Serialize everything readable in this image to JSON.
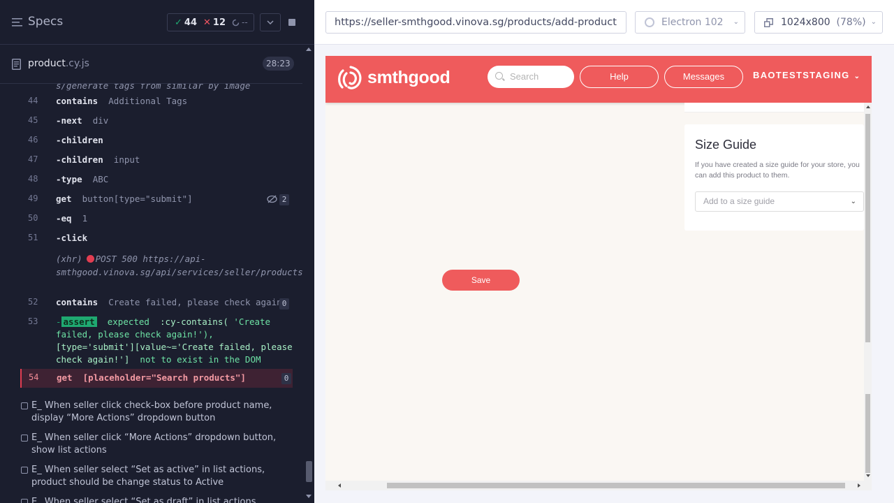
{
  "reporter": {
    "specs_label": "Specs",
    "stats": {
      "passed": "44",
      "failed": "12",
      "pending": "--"
    },
    "file": {
      "name": "product",
      "ext": ".cy.js",
      "duration": "28:23"
    },
    "cut_line": "s/generate tags from similar by image",
    "commands": [
      {
        "num": "44",
        "name": "contains",
        "msg": "Additional Tags"
      },
      {
        "num": "45",
        "name": "-next",
        "msg": "div"
      },
      {
        "num": "46",
        "name": "-children",
        "msg": ""
      },
      {
        "num": "47",
        "name": "-children",
        "msg": "input"
      },
      {
        "num": "48",
        "name": "-type",
        "msg": "ABC"
      },
      {
        "num": "49",
        "name": "get",
        "msg": "button[type=\"submit\"]",
        "badge": "2"
      },
      {
        "num": "50",
        "name": "-eq",
        "msg": "1"
      },
      {
        "num": "51",
        "name": "-click",
        "msg": ""
      },
      {
        "num": "52",
        "name": "contains",
        "msg": "Create failed, please check again!",
        "badge": "0"
      },
      {
        "num": "53",
        "name": "-",
        "msg": ""
      },
      {
        "num": "54",
        "name": "get",
        "msg": "[placeholder=\"Search products\"]",
        "badge": "0"
      }
    ],
    "xhr": {
      "label": "(xhr)",
      "text": "POST 500 https://api-smthgood.vinova.sg/api/services/seller/products"
    },
    "assert": {
      "tag": "assert",
      "line1_a": "expected",
      "line1_b": ":cy-contains(",
      "line1_c": "'Create",
      "line2": "failed, please check again!'),",
      "line3": "[type='submit'][value~='Create failed, please",
      "line4_a": "check again!']",
      "line4_b": "not to exist in the DOM"
    },
    "tests": [
      "E_ When seller click check-box before product name, display “More Actions” dropdown button",
      "E_ When seller click “More Actions” dropdown button, show list actions",
      "E_ When seller select “Set as active” in list actions, product should be change status to Active",
      "E_ When seller select “Set as draft” in list actions, product should be change status to Draft"
    ]
  },
  "aut": {
    "url": "https://seller-smthgood.vinova.sg/products/add-product",
    "browser": "Electron 102",
    "viewport": "1024x800",
    "zoom": "(78%)"
  },
  "site": {
    "logo_text": "smthgood",
    "search_placeholder": "Search",
    "help": "Help",
    "messages": "Messages",
    "account": "BAOTESTSTAGING",
    "size_guide": {
      "title": "Size Guide",
      "desc": "If you have created a size guide for your store, you can add this product to them.",
      "select_placeholder": "Add to a size guide"
    },
    "save": "Save"
  },
  "colors": {
    "brand": "#ef5b5c",
    "reporter_bg": "#1b1e2e",
    "pass": "#1fa971",
    "fail": "#f05562"
  }
}
